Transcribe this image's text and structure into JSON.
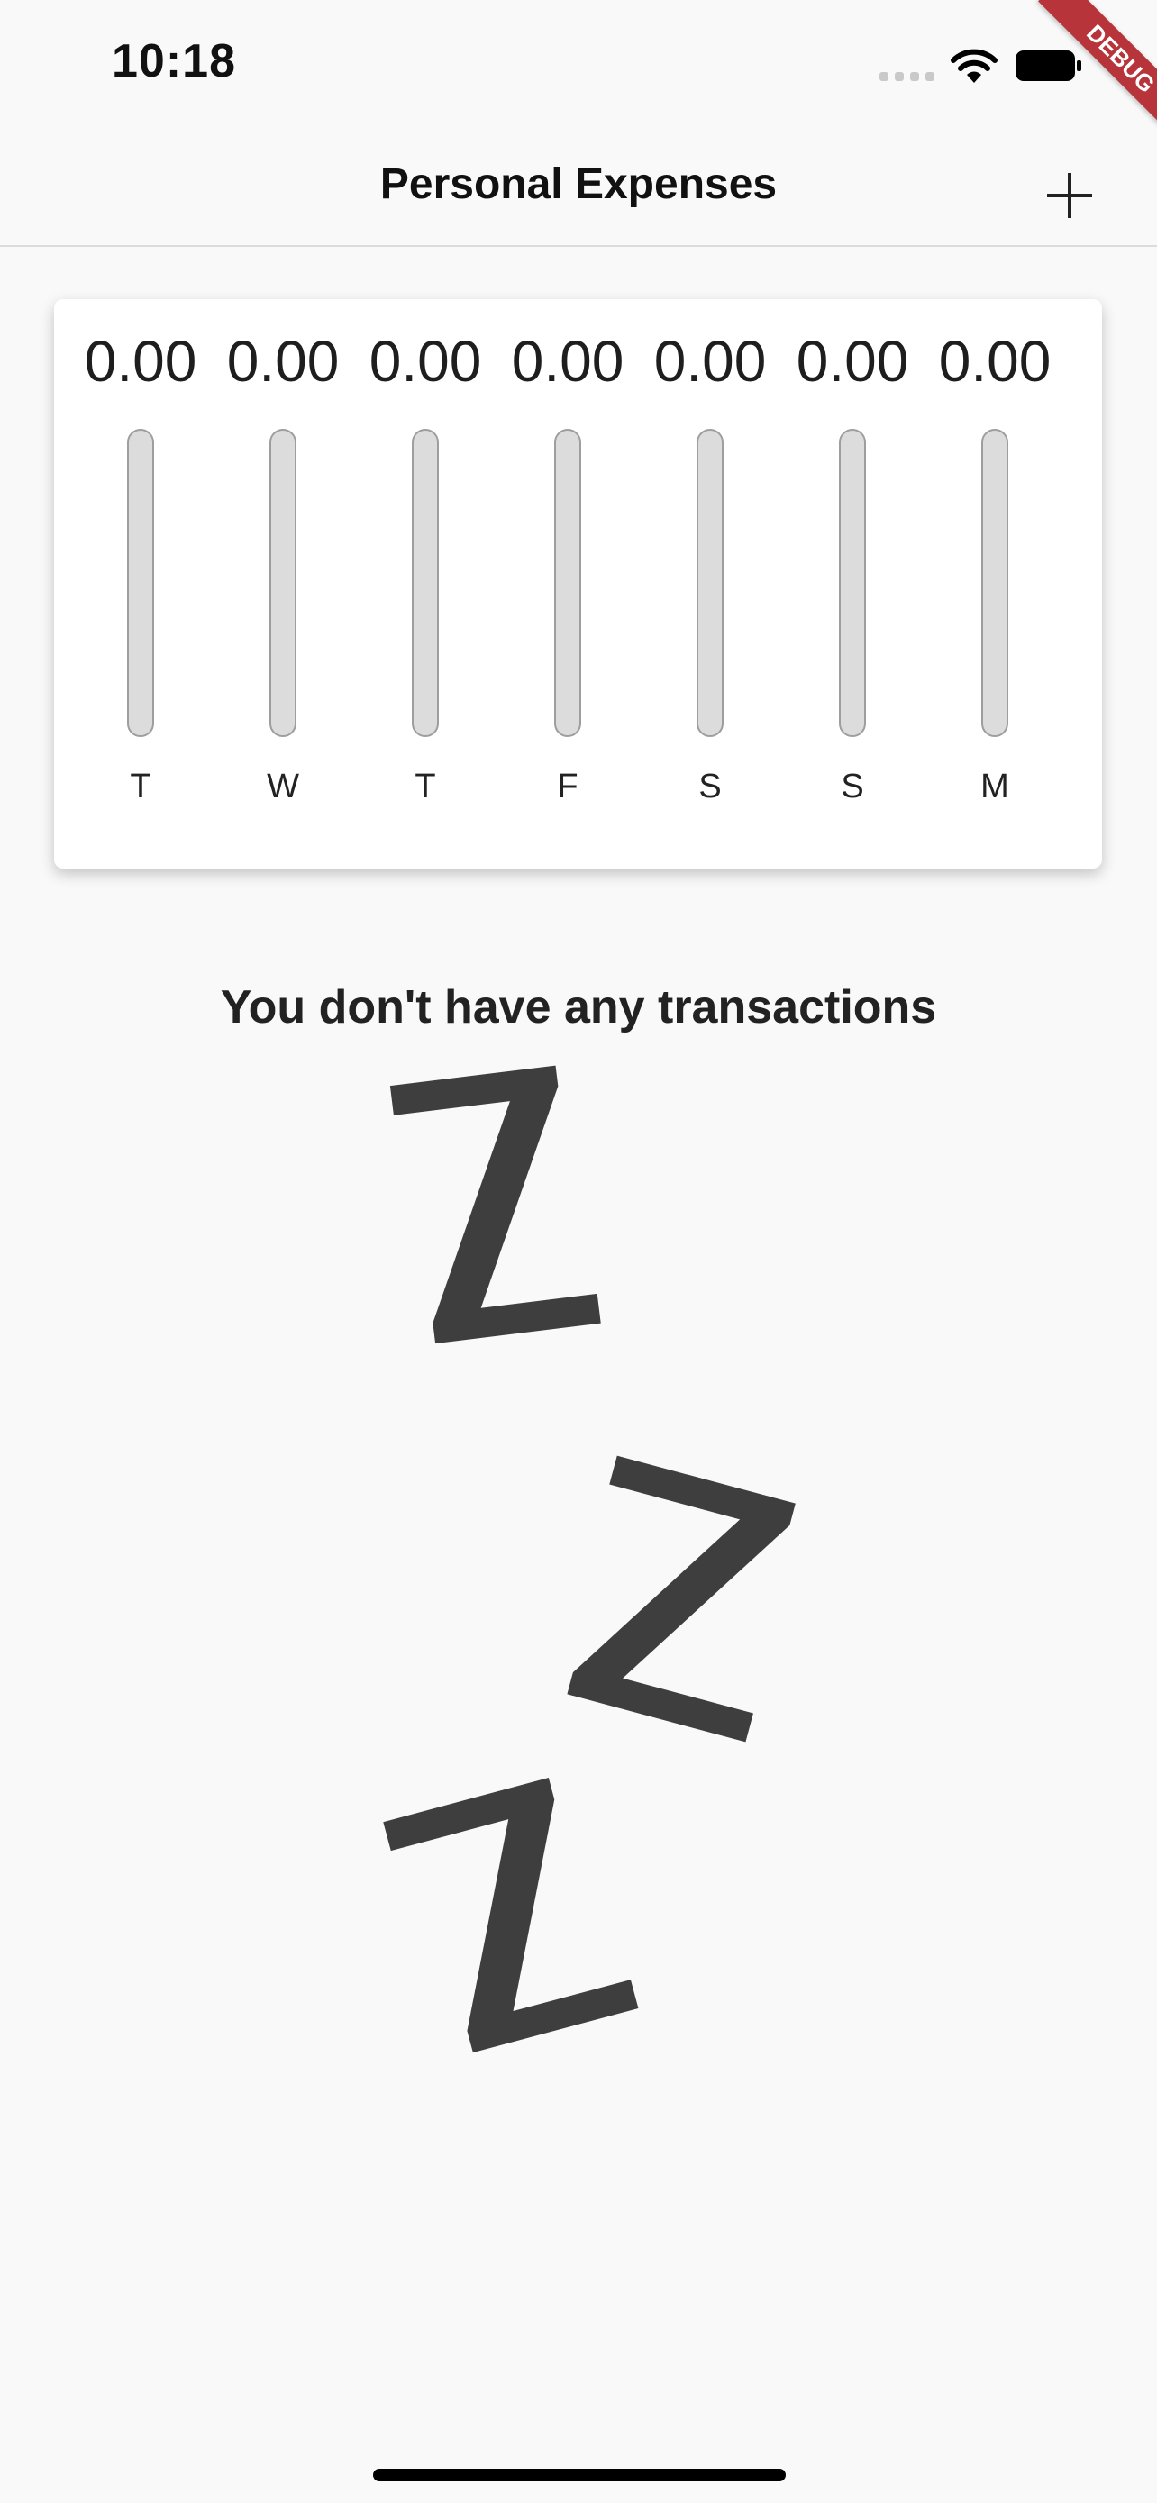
{
  "status_bar": {
    "time": "10:18",
    "icons": [
      "signal-icon",
      "wifi-icon",
      "battery-icon"
    ]
  },
  "debug_banner": {
    "label": "DEBUG",
    "color": "#b7353a"
  },
  "nav": {
    "title": "Personal Expenses",
    "add_icon": "plus-icon"
  },
  "chart_data": {
    "type": "bar",
    "categories": [
      "T",
      "W",
      "T",
      "F",
      "S",
      "S",
      "M"
    ],
    "values": [
      0.0,
      0.0,
      0.0,
      0.0,
      0.0,
      0.0,
      0.0
    ],
    "value_labels": [
      "0.00",
      "0.00",
      "0.00",
      "0.00",
      "0.00",
      "0.00",
      "0.00"
    ],
    "fill_fraction": [
      0,
      0,
      0,
      0,
      0,
      0,
      0
    ],
    "fill_color": "#6a1b9a",
    "track_color": "#dcdcdc"
  },
  "empty_state": {
    "title": "You don't have any transactions",
    "image": "sleeping-z-icon"
  }
}
